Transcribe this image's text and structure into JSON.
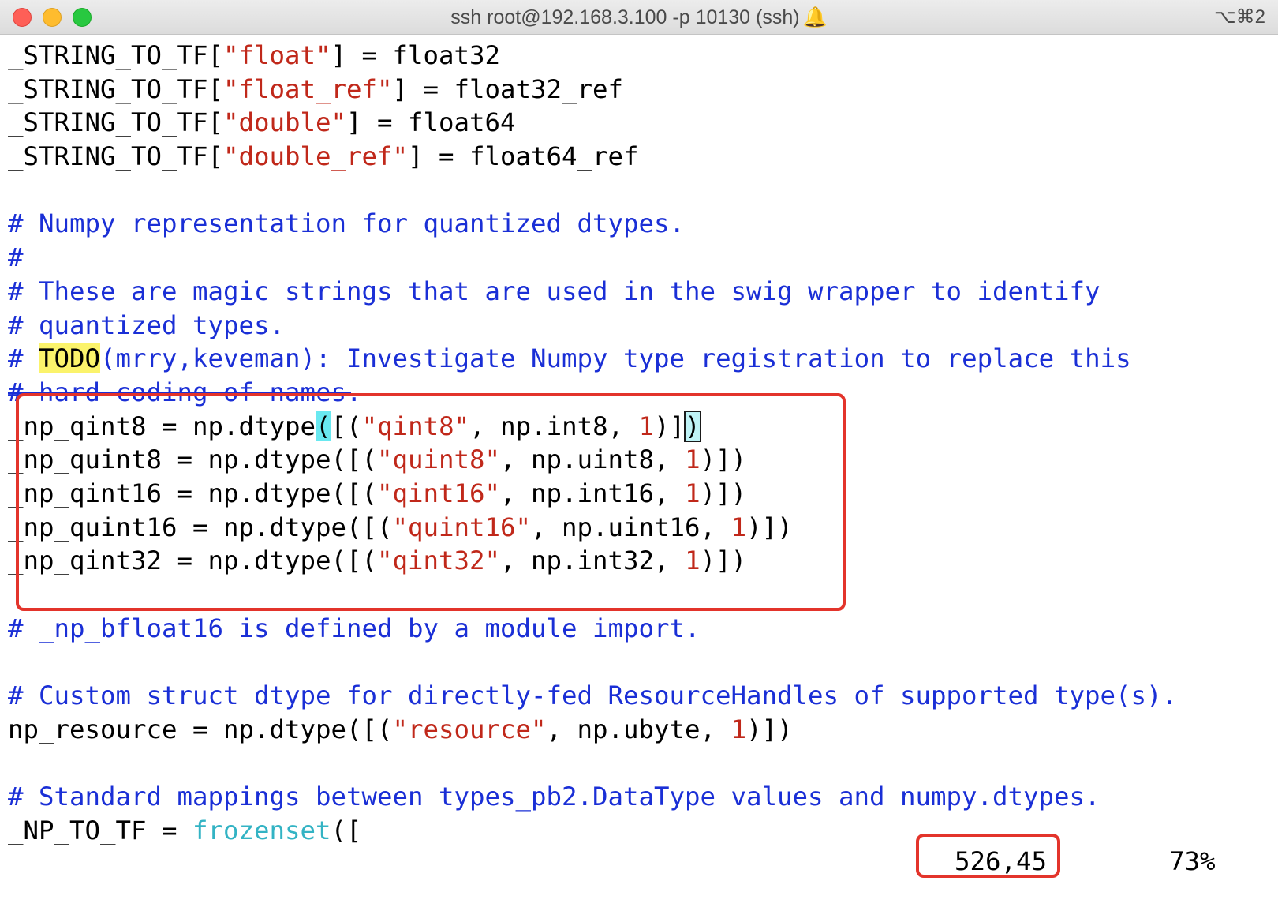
{
  "window": {
    "title": "ssh root@192.168.3.100 -p 10130 (ssh)",
    "bell": "🔔",
    "shortcut": "⌥⌘2"
  },
  "lines": [
    [
      "_STRING_TO_TF[",
      "\"float\"",
      "] = float32"
    ],
    [
      "_STRING_TO_TF[",
      "\"float_ref\"",
      "] = float32_ref"
    ],
    [
      "_STRING_TO_TF[",
      "\"double\"",
      "] = float64"
    ],
    [
      "_STRING_TO_TF[",
      "\"double_ref\"",
      "] = float64_ref"
    ],
    [
      ""
    ],
    [
      "# Numpy representation for quantized dtypes."
    ],
    [
      "#"
    ],
    [
      "# These are magic strings that are used in the swig wrapper to identify"
    ],
    [
      "# quantized types."
    ],
    [
      "# ",
      "TODO",
      "(mrry,keveman): Investigate Numpy type registration to replace this"
    ],
    [
      "# hard coding of names."
    ],
    [
      "_np_qint8 = np.dtype",
      "(",
      "[(",
      "\"qint8\"",
      ", np.int8, ",
      "1",
      ")]",
      ")"
    ],
    [
      "_np_quint8 = np.dtype([(",
      "\"quint8\"",
      ", np.uint8, ",
      "1",
      ")])"
    ],
    [
      "_np_qint16 = np.dtype([(",
      "\"qint16\"",
      ", np.int16, ",
      "1",
      ")])"
    ],
    [
      "_np_quint16 = np.dtype([(",
      "\"quint16\"",
      ", np.uint16, ",
      "1",
      ")])"
    ],
    [
      "_np_qint32 = np.dtype([(",
      "\"qint32\"",
      ", np.int32, ",
      "1",
      ")])"
    ],
    [
      ""
    ],
    [
      "# _np_bfloat16 is defined by a module import."
    ],
    [
      ""
    ],
    [
      "# Custom struct dtype for directly-fed ResourceHandles of supported type(s)."
    ],
    [
      "np_resource = np.dtype([(",
      "\"resource\"",
      ", np.ubyte, ",
      "1",
      ")])"
    ],
    [
      ""
    ],
    [
      "# Standard mappings between types_pb2.DataType values and numpy.dtypes."
    ],
    [
      "_NP_TO_TF = ",
      "frozenset",
      "(["
    ]
  ],
  "status": {
    "position": "526,45",
    "percent": "73%"
  },
  "colors": {
    "string": "#c0281a",
    "comment": "#1a2fd6",
    "number": "#c0281a",
    "builtin": "#33b3c4",
    "todo_bg": "#fbf36b",
    "annotation_box": "#e3342b"
  }
}
